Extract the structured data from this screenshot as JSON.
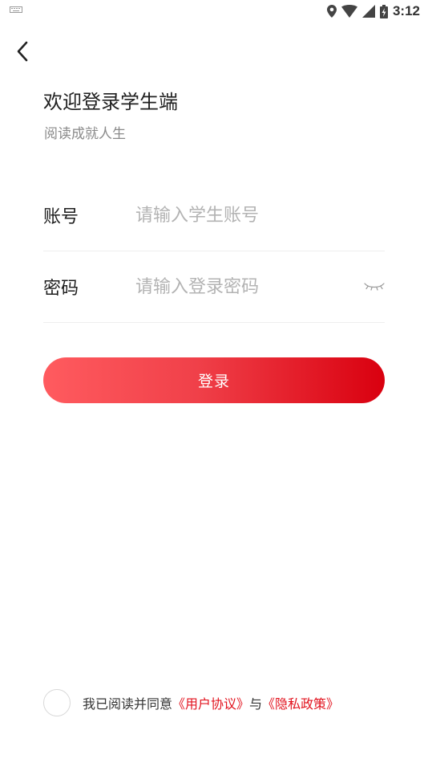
{
  "status_bar": {
    "time": "3:12"
  },
  "header": {
    "title": "欢迎登录学生端",
    "subtitle": "阅读成就人生"
  },
  "form": {
    "account_label": "账号",
    "account_placeholder": "请输入学生账号",
    "account_value": "",
    "password_label": "密码",
    "password_placeholder": "请输入登录密码",
    "password_value": ""
  },
  "login_button": {
    "label": "登录"
  },
  "agreement": {
    "prefix": "我已阅读并同意",
    "user_agreement": "《用户协议》",
    "conjunction": "与",
    "privacy_policy": "《隐私政策》",
    "checked": false
  },
  "colors": {
    "accent": "#e2121d",
    "button_gradient_start": "#ff5b5f",
    "button_gradient_end": "#d9000f"
  },
  "icons": [
    "keyboard-icon",
    "location-icon",
    "wifi-icon",
    "signal-icon",
    "battery-icon",
    "back-arrow-icon",
    "eye-closed-icon"
  ]
}
